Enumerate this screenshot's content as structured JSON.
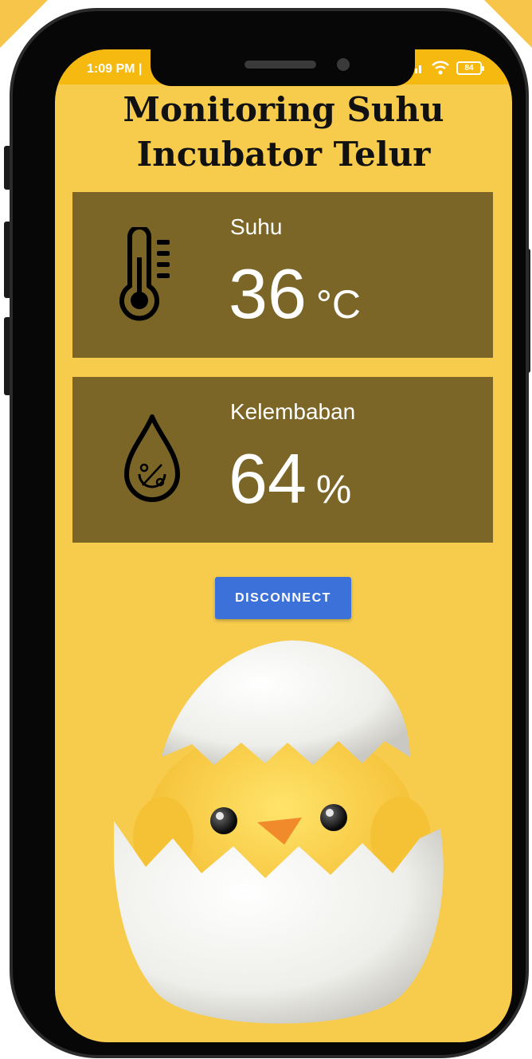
{
  "status_bar": {
    "time": "1:09 PM | ",
    "battery": "84"
  },
  "app": {
    "title_line1": "Monitoring Suhu",
    "title_line2": "Incubator Telur"
  },
  "temperature": {
    "label": "Suhu",
    "value": "36",
    "unit": "°C",
    "icon": "thermometer-icon"
  },
  "humidity": {
    "label": "Kelembaban",
    "value": "64",
    "unit": "%",
    "icon": "humidity-drop-icon"
  },
  "actions": {
    "disconnect_label": "DISCONNECT"
  },
  "colors": {
    "screen_background": "#f7cc4d",
    "status_bar": "#f5b90f",
    "card_background": "#7b6628",
    "button": "#3b71d9"
  }
}
